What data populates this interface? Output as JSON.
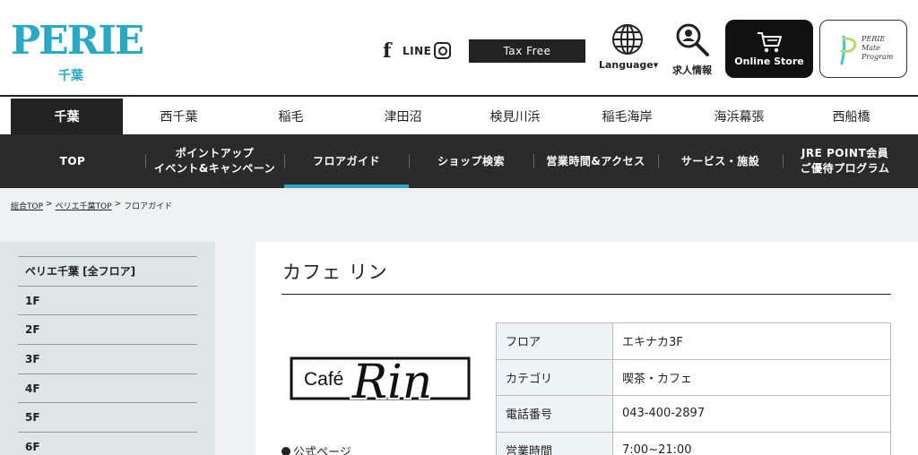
{
  "header": {
    "logo_text": "PERIE",
    "logo_sub": "千葉",
    "line_label": "LINE",
    "tax_free_label": "Tax Free",
    "language_label": "Language▾",
    "jobs_label": "求人情報",
    "online_store_label": "Online Store",
    "mate_program_label": "PERIE\nMate\nProgram",
    "brand_color": "#2aa8c4"
  },
  "location_tabs": [
    {
      "label": "千葉",
      "active": true
    },
    {
      "label": "西千葉"
    },
    {
      "label": "稲毛"
    },
    {
      "label": "津田沼"
    },
    {
      "label": "検見川浜"
    },
    {
      "label": "稲毛海岸"
    },
    {
      "label": "海浜幕張"
    },
    {
      "label": "西船橋"
    }
  ],
  "main_nav": [
    {
      "label": "TOP"
    },
    {
      "label": "ポイントアップ\nイベント&キャンペーン"
    },
    {
      "label": "フロアガイド",
      "active": true
    },
    {
      "label": "ショップ検索"
    },
    {
      "label": "営業時間&アクセス"
    },
    {
      "label": "サービス・施設"
    },
    {
      "label": "JRE POINT会員\nご優待プログラム"
    }
  ],
  "breadcrumb": [
    {
      "label": "総合TOP"
    },
    {
      "label": "ペリエ千葉TOP"
    },
    {
      "label": "フロアガイド"
    }
  ],
  "breadcrumb_separator": ">",
  "sidebar": {
    "items": [
      {
        "label": "ペリエ千葉 [全フロア]"
      },
      {
        "label": "1F"
      },
      {
        "label": "2F"
      },
      {
        "label": "3F"
      },
      {
        "label": "4F"
      },
      {
        "label": "5F"
      },
      {
        "label": "6F"
      }
    ]
  },
  "shop": {
    "title": "カフェ リン",
    "logo_text_small": "Café",
    "logo_text_script": "Rin",
    "official_page_label": "公式ページ",
    "details": [
      {
        "label": "フロア",
        "value": "エキナカ3F"
      },
      {
        "label": "カテゴリ",
        "value": "喫茶・カフェ"
      },
      {
        "label": "電話番号",
        "value": "043-400-2897"
      },
      {
        "label": "営業時間",
        "value": "7:00~21:00"
      }
    ]
  }
}
